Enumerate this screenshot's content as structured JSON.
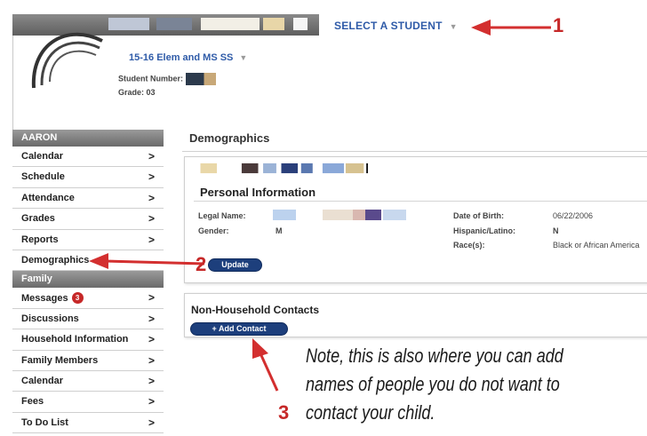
{
  "header": {
    "select_student_label": "SELECT A STUDENT",
    "school_name": "15-16 Elem and MS SS",
    "student_number_label": "Student Number:",
    "grade_label": "Grade: 03"
  },
  "sidebar": {
    "student_header": "AARON",
    "student_items": [
      {
        "label": "Calendar"
      },
      {
        "label": "Schedule"
      },
      {
        "label": "Attendance"
      },
      {
        "label": "Grades"
      },
      {
        "label": "Reports"
      },
      {
        "label": "Demographics"
      }
    ],
    "family_header": "Family",
    "family_items": [
      {
        "label": "Messages",
        "badge": "3"
      },
      {
        "label": "Discussions"
      },
      {
        "label": "Household Information"
      },
      {
        "label": "Family Members"
      },
      {
        "label": "Calendar"
      },
      {
        "label": "Fees"
      },
      {
        "label": "To Do List"
      }
    ]
  },
  "main": {
    "page_title": "Demographics",
    "personal_info": {
      "title": "Personal Information",
      "legal_name_label": "Legal Name:",
      "gender_label": "Gender:",
      "gender_value": "M",
      "dob_label": "Date of Birth:",
      "dob_value": "06/22/2006",
      "hispanic_label": "Hispanic/Latino:",
      "hispanic_value": "N",
      "race_label": "Race(s):",
      "race_value": "Black or African America",
      "update_button": "Update"
    },
    "non_household": {
      "title": "Non-Household Contacts",
      "add_button": "+ Add Contact"
    }
  },
  "annotations": {
    "marker1": "1",
    "marker2": "2",
    "marker3": "3",
    "note": "Note, this is also where you can add names of people you do not want to contact your child.",
    "arrow_color": "#d32f2f"
  }
}
